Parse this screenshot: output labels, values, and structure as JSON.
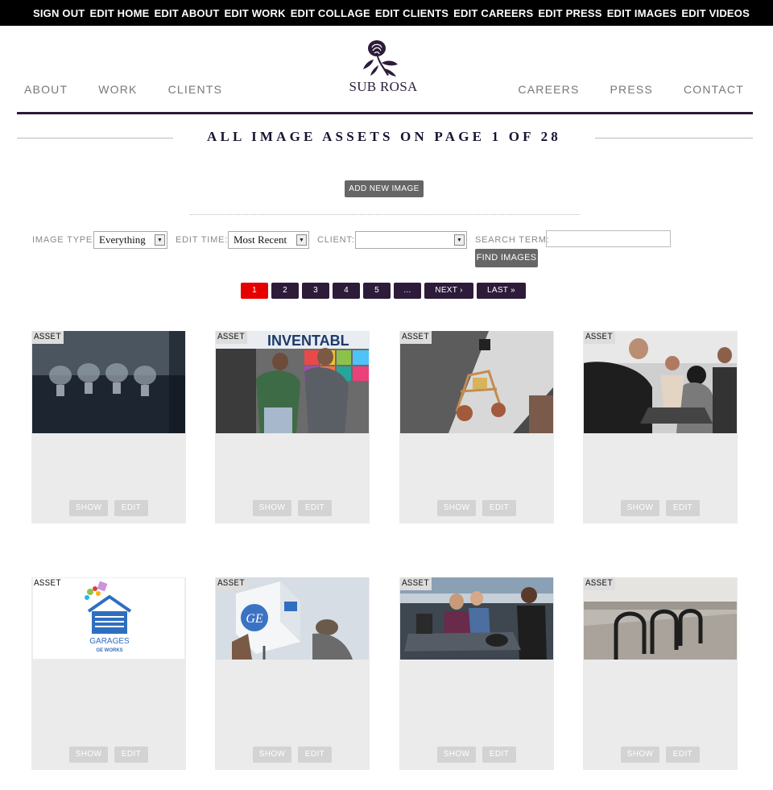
{
  "admin_bar": [
    "SIGN OUT",
    "EDIT HOME",
    "EDIT ABOUT",
    "EDIT WORK",
    "EDIT COLLAGE",
    "EDIT CLIENTS",
    "EDIT CAREERS",
    "EDIT PRESS",
    "EDIT IMAGES",
    "EDIT VIDEOS"
  ],
  "nav": {
    "left": [
      "ABOUT",
      "WORK",
      "CLIENTS"
    ],
    "right": [
      "CAREERS",
      "PRESS",
      "CONTACT"
    ],
    "logo_text": "SUB ROSA"
  },
  "heading": "ALL IMAGE ASSETS ON PAGE 1 OF 28",
  "add_button": "ADD NEW IMAGE",
  "filters": {
    "image_type_label": "IMAGE TYPE:",
    "image_type_value": "Everything",
    "edit_time_label": "EDIT TIME:",
    "edit_time_value": "Most Recent",
    "client_label": "CLIENT:",
    "client_value": "",
    "search_label": "SEARCH TERM:",
    "search_value": "",
    "find_button": "FIND IMAGES"
  },
  "pagination": {
    "pages": [
      "1",
      "2",
      "3",
      "4",
      "5",
      "..."
    ],
    "current": "1",
    "next": "NEXT ›",
    "last": "LAST »"
  },
  "asset_tag": "ASSET",
  "show_label": "SHOW",
  "edit_label": "EDIT",
  "assets": [
    {
      "thumb": "lightbulbs-photo"
    },
    {
      "thumb": "inventables-photo",
      "sign_text": "INVENTABL"
    },
    {
      "thumb": "robot-photo"
    },
    {
      "thumb": "workshop-crowd-photo"
    },
    {
      "thumb": "garages-logo",
      "logo_line1": "GARAGES",
      "logo_line2": "GE WORKS"
    },
    {
      "thumb": "ge-cube-photo",
      "sign_text": "GE"
    },
    {
      "thumb": "welding-photo"
    },
    {
      "thumb": "bike-rack-photo"
    }
  ],
  "colors": {
    "brand": "#2d1b3a",
    "active_page": "#e60000",
    "button_gray": "#666666",
    "card_bg": "#ebebeb"
  }
}
